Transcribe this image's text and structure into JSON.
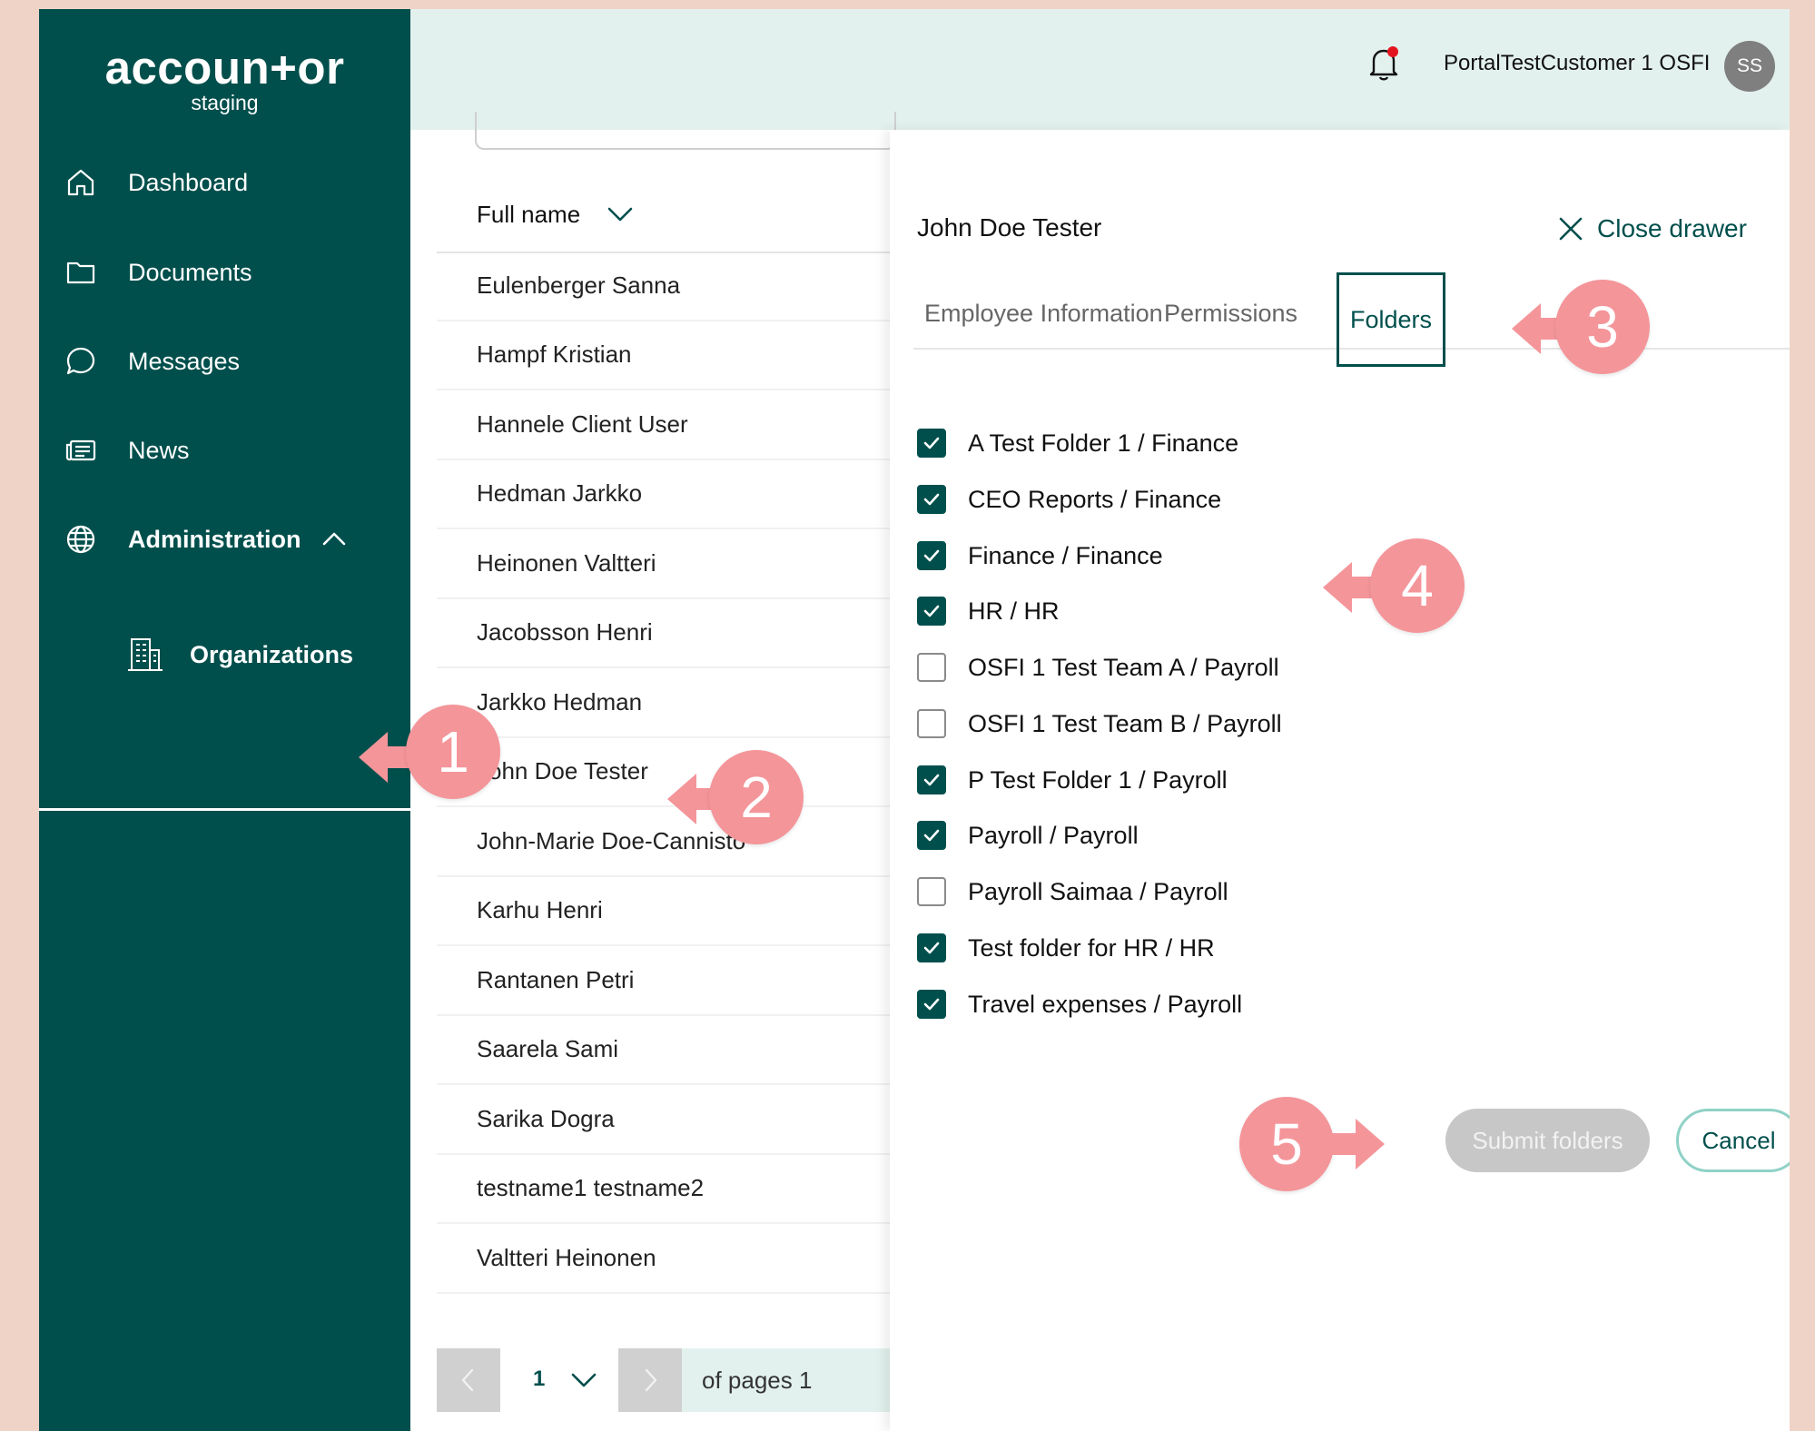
{
  "app": {
    "brand": "accoun+or",
    "environment": "staging"
  },
  "sidebar": {
    "items": [
      {
        "label": "Dashboard",
        "icon": "home-icon"
      },
      {
        "label": "Documents",
        "icon": "folder-icon"
      },
      {
        "label": "Messages",
        "icon": "chat-icon"
      },
      {
        "label": "News",
        "icon": "newspaper-icon"
      },
      {
        "label": "Administration",
        "icon": "globe-icon",
        "expanded": true
      }
    ],
    "subitems": [
      {
        "label": "Organizations",
        "icon": "building-icon",
        "active": true
      }
    ]
  },
  "header": {
    "user_name": "PortalTestCustomer 1 OSFI",
    "avatar_initials": "SS",
    "notification_icon": "bell-icon",
    "has_notification": true
  },
  "list": {
    "column_header": "Full name",
    "rows": [
      "Eulenberger Sanna",
      "Hampf Kristian",
      "Hannele Client User",
      "Hedman Jarkko",
      "Heinonen Valtteri",
      "Jacobsson Henri",
      "Jarkko Hedman",
      "John Doe Tester",
      "John-Marie Doe-Cannisto",
      "Karhu Henri",
      "Rantanen Petri",
      "Saarela Sami",
      "Sarika Dogra",
      "testname1 testname2",
      "Valtteri Heinonen"
    ],
    "pagination": {
      "current_page": "1",
      "of_pages_label": "of pages 1"
    }
  },
  "drawer": {
    "title": "John Doe Tester",
    "close_label": "Close drawer",
    "tabs": [
      {
        "label": "Employee Information",
        "active": false
      },
      {
        "label": "Permissions",
        "active": false
      },
      {
        "label": "Folders",
        "active": true
      }
    ],
    "folders": [
      {
        "label": "A Test Folder 1 / Finance",
        "checked": true
      },
      {
        "label": "CEO Reports / Finance",
        "checked": true
      },
      {
        "label": "Finance / Finance",
        "checked": true
      },
      {
        "label": "HR / HR",
        "checked": true
      },
      {
        "label": "OSFI 1 Test Team A / Payroll",
        "checked": false
      },
      {
        "label": "OSFI 1 Test Team B / Payroll",
        "checked": false
      },
      {
        "label": "P Test Folder 1 / Payroll",
        "checked": true
      },
      {
        "label": "Payroll / Payroll",
        "checked": true
      },
      {
        "label": "Payroll Saimaa / Payroll",
        "checked": false
      },
      {
        "label": "Test folder for HR / HR",
        "checked": true
      },
      {
        "label": "Travel expenses / Payroll",
        "checked": true
      }
    ],
    "submit_label": "Submit folders",
    "submit_disabled": true,
    "cancel_label": "Cancel"
  },
  "callouts": [
    "1",
    "2",
    "3",
    "4",
    "5"
  ],
  "colors": {
    "sidebar_bg": "#004f4c",
    "header_bg": "#e3f1ee",
    "accent": "#004f4c",
    "callout": "#f4959a",
    "page_bg": "#f0d3c7"
  }
}
